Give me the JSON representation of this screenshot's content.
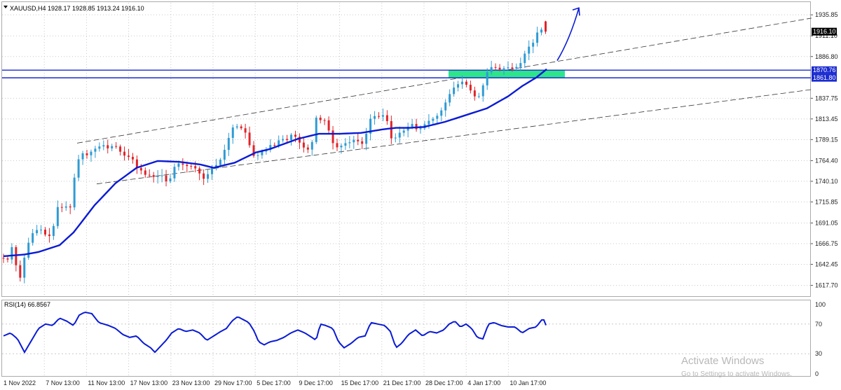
{
  "header": {
    "arrow_icon": "triangle-down-icon",
    "title": "XAUUSD,H4  1928.17 1928.85 1913.24 1916.10"
  },
  "indicator": {
    "title": "RSI(14) 66.8567"
  },
  "watermark": {
    "line1": "Activate Windows",
    "line2": "Go to Settings to activate Windows."
  },
  "colors": {
    "background": "#ffffff",
    "bull": "#2f9bd3",
    "bear": "#e0242a",
    "ma": "#0a1bd4",
    "level": "#1a2bd0",
    "zone": "#2ee58a",
    "grid": "#c8c8c8"
  },
  "chart_data": [
    {
      "type": "candlestick",
      "symbol": "XAUUSD",
      "timeframe": "H4",
      "last": {
        "open": 1928.17,
        "high": 1928.85,
        "low": 1913.24,
        "close": 1916.1
      },
      "ylim": [
        1605,
        1950
      ],
      "y_ticks": [
        "1935.85",
        "1911.10",
        "1886.80",
        "1837.75",
        "1813.45",
        "1789.15",
        "1764.40",
        "1740.10",
        "1715.85",
        "1691.05",
        "1666.75",
        "1642.45",
        "1617.70"
      ],
      "x_ticks": [
        "1 Nov 2022",
        "7 Nov 13:00",
        "11 Nov 13:00",
        "17 Nov 13:00",
        "23 Nov 13:00",
        "29 Nov 17:00",
        "5 Dec 17:00",
        "9 Dec 17:00",
        "15 Dec 17:00",
        "21 Dec 17:00",
        "28 Dec 17:00",
        "4 Jan 17:00",
        "10 Jan 17:00"
      ],
      "price_tags": [
        {
          "label": "1916.10",
          "value": 1916.1,
          "style": "current"
        },
        {
          "label": "1870.76",
          "value": 1870.76,
          "style": "level"
        },
        {
          "label": "1861.80",
          "value": 1861.8,
          "style": "level"
        }
      ],
      "horizontal_levels": [
        1870.76,
        1861.8
      ],
      "support_zone": {
        "from": 1861.8,
        "to": 1870.8
      },
      "price_path": [
        [
          0,
          1650
        ],
        [
          4,
          1646
        ],
        [
          8,
          1653
        ],
        [
          12,
          1648
        ],
        [
          16,
          1658
        ],
        [
          20,
          1668
        ],
        [
          24,
          1640
        ],
        [
          28,
          1625
        ],
        [
          32,
          1629
        ],
        [
          36,
          1652
        ],
        [
          40,
          1664
        ],
        [
          46,
          1678
        ],
        [
          52,
          1682
        ],
        [
          58,
          1685
        ],
        [
          64,
          1678
        ],
        [
          70,
          1676
        ],
        [
          76,
          1675
        ],
        [
          80,
          1712
        ],
        [
          86,
          1708
        ],
        [
          92,
          1710
        ],
        [
          98,
          1711
        ],
        [
          104,
          1708
        ],
        [
          108,
          1755
        ],
        [
          114,
          1768
        ],
        [
          120,
          1774
        ],
        [
          126,
          1770
        ],
        [
          132,
          1776
        ],
        [
          140,
          1780
        ],
        [
          148,
          1783
        ],
        [
          156,
          1778
        ],
        [
          164,
          1784
        ],
        [
          170,
          1777
        ],
        [
          176,
          1772
        ],
        [
          182,
          1768
        ],
        [
          188,
          1770
        ],
        [
          196,
          1756
        ],
        [
          204,
          1752
        ],
        [
          210,
          1746
        ],
        [
          216,
          1748
        ],
        [
          222,
          1744
        ],
        [
          230,
          1748
        ],
        [
          236,
          1745
        ],
        [
          240,
          1735
        ],
        [
          246,
          1748
        ],
        [
          252,
          1762
        ],
        [
          260,
          1760
        ],
        [
          268,
          1758
        ],
        [
          276,
          1758
        ],
        [
          284,
          1752
        ],
        [
          290,
          1742
        ],
        [
          296,
          1746
        ],
        [
          302,
          1756
        ],
        [
          308,
          1758
        ],
        [
          314,
          1763
        ],
        [
          320,
          1774
        ],
        [
          326,
          1788
        ],
        [
          332,
          1803
        ],
        [
          338,
          1805
        ],
        [
          344,
          1803
        ],
        [
          350,
          1800
        ],
        [
          356,
          1785
        ],
        [
          362,
          1770
        ],
        [
          368,
          1770
        ],
        [
          374,
          1775
        ],
        [
          380,
          1776
        ],
        [
          386,
          1783
        ],
        [
          392,
          1781
        ],
        [
          398,
          1788
        ],
        [
          404,
          1790
        ],
        [
          410,
          1788
        ],
        [
          416,
          1795
        ],
        [
          422,
          1793
        ],
        [
          428,
          1786
        ],
        [
          434,
          1780
        ],
        [
          440,
          1777
        ],
        [
          446,
          1785
        ],
        [
          452,
          1815
        ],
        [
          458,
          1812
        ],
        [
          464,
          1812
        ],
        [
          470,
          1800
        ],
        [
          476,
          1785
        ],
        [
          482,
          1780
        ],
        [
          488,
          1782
        ],
        [
          494,
          1785
        ],
        [
          500,
          1786
        ],
        [
          506,
          1789
        ],
        [
          512,
          1787
        ],
        [
          518,
          1784
        ],
        [
          524,
          1797
        ],
        [
          530,
          1815
        ],
        [
          536,
          1817
        ],
        [
          542,
          1816
        ],
        [
          548,
          1818
        ],
        [
          554,
          1810
        ],
        [
          560,
          1788
        ],
        [
          566,
          1792
        ],
        [
          572,
          1798
        ],
        [
          578,
          1800
        ],
        [
          584,
          1805
        ],
        [
          590,
          1808
        ],
        [
          596,
          1800
        ],
        [
          602,
          1803
        ],
        [
          608,
          1808
        ],
        [
          614,
          1812
        ],
        [
          620,
          1814
        ],
        [
          626,
          1818
        ],
        [
          632,
          1825
        ],
        [
          638,
          1835
        ],
        [
          644,
          1845
        ],
        [
          650,
          1852
        ],
        [
          656,
          1855
        ],
        [
          662,
          1858
        ],
        [
          668,
          1852
        ],
        [
          674,
          1845
        ],
        [
          680,
          1838
        ],
        [
          686,
          1841
        ],
        [
          692,
          1858
        ],
        [
          698,
          1873
        ],
        [
          704,
          1875
        ],
        [
          710,
          1873
        ],
        [
          716,
          1871
        ],
        [
          722,
          1874
        ],
        [
          728,
          1874
        ],
        [
          734,
          1872
        ],
        [
          740,
          1876
        ],
        [
          746,
          1881
        ],
        [
          752,
          1896
        ],
        [
          758,
          1900
        ],
        [
          764,
          1905
        ],
        [
          770,
          1922
        ],
        [
          776,
          1916
        ]
      ],
      "ma_path": [
        [
          0,
          1652
        ],
        [
          30,
          1654
        ],
        [
          50,
          1657
        ],
        [
          80,
          1665
        ],
        [
          100,
          1680
        ],
        [
          130,
          1712
        ],
        [
          160,
          1738
        ],
        [
          190,
          1756
        ],
        [
          220,
          1764
        ],
        [
          250,
          1763
        ],
        [
          280,
          1760
        ],
        [
          300,
          1756
        ],
        [
          330,
          1762
        ],
        [
          360,
          1774
        ],
        [
          380,
          1778
        ],
        [
          400,
          1784
        ],
        [
          420,
          1790
        ],
        [
          450,
          1796
        ],
        [
          480,
          1796
        ],
        [
          510,
          1797
        ],
        [
          540,
          1801
        ],
        [
          560,
          1803
        ],
        [
          580,
          1803
        ],
        [
          600,
          1804
        ],
        [
          630,
          1810
        ],
        [
          660,
          1818
        ],
        [
          690,
          1826
        ],
        [
          720,
          1840
        ],
        [
          740,
          1852
        ],
        [
          760,
          1862
        ],
        [
          775,
          1872
        ]
      ],
      "channel_lines": [
        {
          "from": [
            105,
            1785
          ],
          "to": [
            1158,
            1932
          ]
        },
        {
          "from": [
            133,
            1737
          ],
          "to": [
            1158,
            1848
          ]
        }
      ],
      "projection_arrow": {
        "from": [
          795,
          1882
        ],
        "to": [
          826,
          1944
        ],
        "label": ""
      }
    },
    {
      "type": "line",
      "name": "RSI(14)",
      "ylim": [
        0,
        100
      ],
      "y_ticks": [
        "100",
        "70",
        "30",
        "0"
      ],
      "path": [
        [
          0,
          54
        ],
        [
          10,
          58
        ],
        [
          20,
          50
        ],
        [
          30,
          32
        ],
        [
          40,
          48
        ],
        [
          50,
          64
        ],
        [
          60,
          70
        ],
        [
          70,
          68
        ],
        [
          80,
          78
        ],
        [
          90,
          74
        ],
        [
          100,
          68
        ],
        [
          108,
          82
        ],
        [
          116,
          86
        ],
        [
          126,
          84
        ],
        [
          136,
          72
        ],
        [
          150,
          68
        ],
        [
          160,
          64
        ],
        [
          170,
          56
        ],
        [
          180,
          52
        ],
        [
          190,
          54
        ],
        [
          200,
          44
        ],
        [
          210,
          38
        ],
        [
          216,
          32
        ],
        [
          224,
          40
        ],
        [
          232,
          48
        ],
        [
          240,
          58
        ],
        [
          250,
          64
        ],
        [
          260,
          60
        ],
        [
          270,
          62
        ],
        [
          280,
          58
        ],
        [
          290,
          48
        ],
        [
          300,
          54
        ],
        [
          310,
          60
        ],
        [
          318,
          64
        ],
        [
          326,
          74
        ],
        [
          334,
          80
        ],
        [
          342,
          76
        ],
        [
          350,
          72
        ],
        [
          358,
          60
        ],
        [
          364,
          46
        ],
        [
          372,
          42
        ],
        [
          380,
          46
        ],
        [
          390,
          48
        ],
        [
          400,
          52
        ],
        [
          410,
          58
        ],
        [
          420,
          62
        ],
        [
          430,
          58
        ],
        [
          440,
          52
        ],
        [
          446,
          48
        ],
        [
          452,
          70
        ],
        [
          460,
          68
        ],
        [
          470,
          64
        ],
        [
          478,
          46
        ],
        [
          486,
          38
        ],
        [
          496,
          44
        ],
        [
          506,
          52
        ],
        [
          516,
          54
        ],
        [
          524,
          72
        ],
        [
          534,
          70
        ],
        [
          544,
          68
        ],
        [
          552,
          60
        ],
        [
          560,
          38
        ],
        [
          568,
          44
        ],
        [
          578,
          56
        ],
        [
          588,
          62
        ],
        [
          598,
          54
        ],
        [
          608,
          60
        ],
        [
          618,
          58
        ],
        [
          628,
          62
        ],
        [
          636,
          70
        ],
        [
          644,
          74
        ],
        [
          652,
          66
        ],
        [
          660,
          70
        ],
        [
          668,
          64
        ],
        [
          676,
          52
        ],
        [
          684,
          50
        ],
        [
          692,
          70
        ],
        [
          700,
          72
        ],
        [
          710,
          68
        ],
        [
          720,
          66
        ],
        [
          730,
          66
        ],
        [
          740,
          58
        ],
        [
          750,
          64
        ],
        [
          760,
          66
        ],
        [
          770,
          78
        ],
        [
          775,
          66
        ]
      ]
    }
  ]
}
